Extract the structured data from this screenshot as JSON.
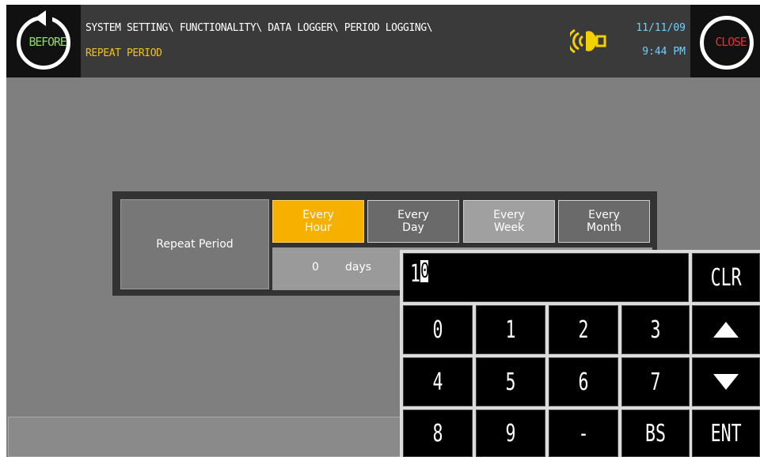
{
  "header": {
    "before_label": "BEFORE",
    "close_label": "CLOSE",
    "path_line1": "SYSTEM SETTING\\ FUNCTIONALITY\\ DATA LOGGER\\ PERIOD LOGGING\\",
    "path_line2": "REPEAT PERIOD",
    "date": "11/11/09",
    "time": "9:44 PM",
    "icons": {
      "before": "rotate-back-icon",
      "buzzer": "buzzer-icon"
    }
  },
  "period": {
    "label": "Repeat Period",
    "options": [
      {
        "line1": "Every",
        "line2": "Hour",
        "selected": true
      },
      {
        "line1": "Every",
        "line2": "Day",
        "selected": false
      },
      {
        "line1": "Every",
        "line2": "Week",
        "selected": false
      },
      {
        "line1": "Every",
        "line2": "Month",
        "selected": false
      }
    ],
    "days_value": "0",
    "days_unit": "days"
  },
  "keypad": {
    "display_value": "1",
    "display_cursor": "0",
    "clear": "CLR",
    "keys_row1": [
      "0",
      "1",
      "2",
      "3"
    ],
    "keys_row2": [
      "4",
      "5",
      "6",
      "7"
    ],
    "keys_row3": [
      "8",
      "9",
      "-",
      "BS"
    ],
    "up_icon": "up-arrow-icon",
    "down_icon": "down-arrow-icon",
    "enter": "ENT"
  },
  "colors": {
    "selected": "#f5b000",
    "header_bg": "#3a3a3a",
    "path_highlight": "#f0c020",
    "clock": "#6fd0ff",
    "before_text": "#8fd66a",
    "close_text": "#e0303a"
  }
}
